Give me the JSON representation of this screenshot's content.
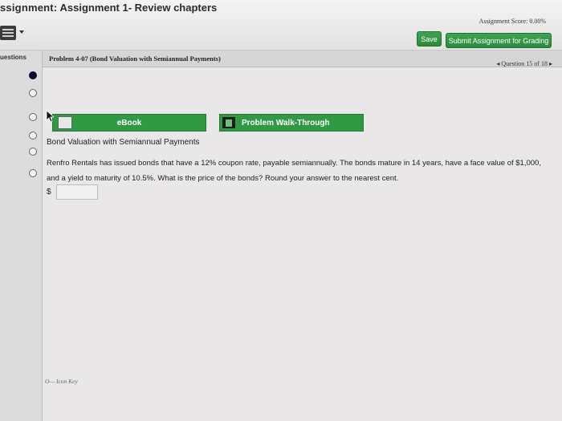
{
  "header": {
    "title_prefix": "ssignment:",
    "title_name": "Assignment 1- Review chapters",
    "score_text": "Assignment Score: 0.00%",
    "save_label": "Save",
    "submit_label": "Submit Assignment for Grading",
    "accent_color": "#2f9a43"
  },
  "sidebar": {
    "label": "uestions",
    "questions": [
      {
        "state": "current"
      },
      {
        "state": "unanswered"
      },
      {
        "state": "unanswered"
      },
      {
        "state": "unanswered"
      },
      {
        "state": "unanswered"
      },
      {
        "state": "unanswered"
      },
      {
        "state": "unanswered"
      }
    ]
  },
  "problem": {
    "title": "Problem 4-07 (Bond Valuation with Semiannual Payments)",
    "nav_text": "◂ Question 15 of 18 ▸",
    "ebook_label": "eBook",
    "walkthrough_label": "Problem Walk-Through",
    "heading": "Bond Valuation with Semiannual Payments",
    "body": "Renfro Rentals has issued bonds that have a 12% coupon rate, payable semiannually. The bonds mature in 14 years, have a face value of $1,000, and a yield to maturity of 10.5%. What is the price of the bonds? Round your answer to the nearest cent.",
    "currency_symbol": "$",
    "answer_value": "",
    "icon_key_label": "O— Icon Key"
  }
}
